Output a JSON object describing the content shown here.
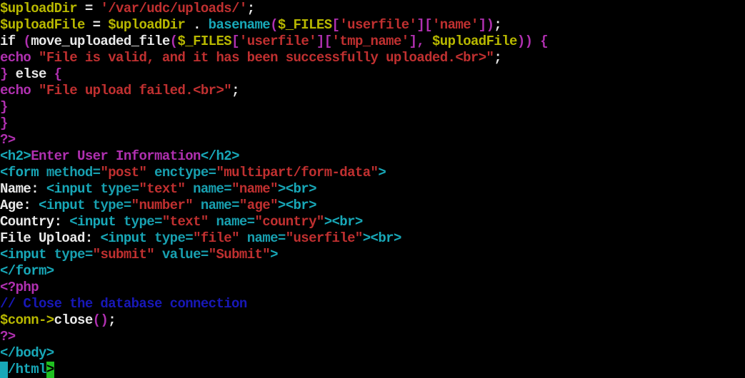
{
  "colors": {
    "background": "#000000",
    "var": "#b8b800",
    "op": "#e8e8e8",
    "plain": "#e8e8e8",
    "string": "#c03030",
    "keyword": "#b030b0",
    "paren": "#b030b0",
    "func": "#18a8b8",
    "tag": "#18a8b8",
    "attr": "#18a0b0",
    "comment": "#1818b8",
    "cursor_bg": "#18a8b8",
    "cursor_end_bg": "#20c020"
  },
  "lines": [
    [
      {
        "t": "$uploadDir",
        "c": "var"
      },
      {
        "t": " = ",
        "c": "op"
      },
      {
        "t": "'/var/udc/uploads/'",
        "c": "string"
      },
      {
        "t": ";",
        "c": "op"
      }
    ],
    [
      {
        "t": "$uploadFile",
        "c": "var"
      },
      {
        "t": " = ",
        "c": "op"
      },
      {
        "t": "$uploadDir",
        "c": "var"
      },
      {
        "t": " . ",
        "c": "op"
      },
      {
        "t": "basename",
        "c": "func"
      },
      {
        "t": "(",
        "c": "paren"
      },
      {
        "t": "$_FILES",
        "c": "var"
      },
      {
        "t": "[",
        "c": "paren"
      },
      {
        "t": "'userfile'",
        "c": "string"
      },
      {
        "t": "][",
        "c": "paren"
      },
      {
        "t": "'name'",
        "c": "string"
      },
      {
        "t": "])",
        "c": "paren"
      },
      {
        "t": ";",
        "c": "op"
      }
    ],
    [
      {
        "t": "if",
        "c": "plain"
      },
      {
        "t": " (",
        "c": "paren"
      },
      {
        "t": "move_uploaded_file",
        "c": "plain"
      },
      {
        "t": "(",
        "c": "paren"
      },
      {
        "t": "$_FILES",
        "c": "var"
      },
      {
        "t": "[",
        "c": "paren"
      },
      {
        "t": "'userfile'",
        "c": "string"
      },
      {
        "t": "][",
        "c": "paren"
      },
      {
        "t": "'tmp_name'",
        "c": "string"
      },
      {
        "t": "], ",
        "c": "paren"
      },
      {
        "t": "$uploadFile",
        "c": "var"
      },
      {
        "t": ")) {",
        "c": "paren"
      }
    ],
    [
      {
        "t": "echo",
        "c": "keyword"
      },
      {
        "t": " ",
        "c": "op"
      },
      {
        "t": "\"File is valid, and it has been successfully uploaded.<br>\"",
        "c": "string"
      },
      {
        "t": ";",
        "c": "op"
      }
    ],
    [
      {
        "t": "} ",
        "c": "paren"
      },
      {
        "t": "else",
        "c": "plain"
      },
      {
        "t": " {",
        "c": "paren"
      }
    ],
    [
      {
        "t": "echo",
        "c": "keyword"
      },
      {
        "t": " ",
        "c": "op"
      },
      {
        "t": "\"File upload failed.<br>\"",
        "c": "string"
      },
      {
        "t": ";",
        "c": "op"
      }
    ],
    [
      {
        "t": "}",
        "c": "paren"
      }
    ],
    [
      {
        "t": "}",
        "c": "paren"
      }
    ],
    [
      {
        "t": "?>",
        "c": "keyword"
      }
    ],
    [
      {
        "t": "<h2>",
        "c": "tag"
      },
      {
        "t": "Enter User Information",
        "c": "keyword"
      },
      {
        "t": "</h2>",
        "c": "tag"
      }
    ],
    [
      {
        "t": "<form ",
        "c": "tag"
      },
      {
        "t": "method=",
        "c": "attr"
      },
      {
        "t": "\"post\"",
        "c": "string"
      },
      {
        "t": " enctype=",
        "c": "attr"
      },
      {
        "t": "\"multipart/form-data\"",
        "c": "string"
      },
      {
        "t": ">",
        "c": "tag"
      }
    ],
    [
      {
        "t": "Name: ",
        "c": "plain"
      },
      {
        "t": "<input ",
        "c": "tag"
      },
      {
        "t": "type=",
        "c": "attr"
      },
      {
        "t": "\"text\"",
        "c": "string"
      },
      {
        "t": " name=",
        "c": "attr"
      },
      {
        "t": "\"name\"",
        "c": "string"
      },
      {
        "t": "><br>",
        "c": "tag"
      }
    ],
    [
      {
        "t": "Age: ",
        "c": "plain"
      },
      {
        "t": "<input ",
        "c": "tag"
      },
      {
        "t": "type=",
        "c": "attr"
      },
      {
        "t": "\"number\"",
        "c": "string"
      },
      {
        "t": " name=",
        "c": "attr"
      },
      {
        "t": "\"age\"",
        "c": "string"
      },
      {
        "t": "><br>",
        "c": "tag"
      }
    ],
    [
      {
        "t": "Country: ",
        "c": "plain"
      },
      {
        "t": "<input ",
        "c": "tag"
      },
      {
        "t": "type=",
        "c": "attr"
      },
      {
        "t": "\"text\"",
        "c": "string"
      },
      {
        "t": " name=",
        "c": "attr"
      },
      {
        "t": "\"country\"",
        "c": "string"
      },
      {
        "t": "><br>",
        "c": "tag"
      }
    ],
    [
      {
        "t": "File Upload: ",
        "c": "plain"
      },
      {
        "t": "<input ",
        "c": "tag"
      },
      {
        "t": "type=",
        "c": "attr"
      },
      {
        "t": "\"file\"",
        "c": "string"
      },
      {
        "t": " name=",
        "c": "attr"
      },
      {
        "t": "\"userfile\"",
        "c": "string"
      },
      {
        "t": "><br>",
        "c": "tag"
      }
    ],
    [
      {
        "t": "<input ",
        "c": "tag"
      },
      {
        "t": "type=",
        "c": "attr"
      },
      {
        "t": "\"submit\"",
        "c": "string"
      },
      {
        "t": " value=",
        "c": "attr"
      },
      {
        "t": "\"Submit\"",
        "c": "string"
      },
      {
        "t": ">",
        "c": "tag"
      }
    ],
    [
      {
        "t": "</form>",
        "c": "tag"
      }
    ],
    [
      {
        "t": "<?php",
        "c": "keyword"
      }
    ],
    [
      {
        "t": "// Close the database connection",
        "c": "comment"
      }
    ],
    [
      {
        "t": "$conn->",
        "c": "var"
      },
      {
        "t": "close",
        "c": "plain"
      },
      {
        "t": "()",
        "c": "paren"
      },
      {
        "t": ";",
        "c": "op"
      }
    ],
    [
      {
        "t": "?>",
        "c": "keyword"
      }
    ],
    [
      {
        "t": "</body>",
        "c": "tag"
      }
    ],
    [
      {
        "t": "<",
        "c": "cursor"
      },
      {
        "t": "/html",
        "c": "tag"
      },
      {
        "t": ">",
        "c": "cursor_end"
      }
    ]
  ]
}
